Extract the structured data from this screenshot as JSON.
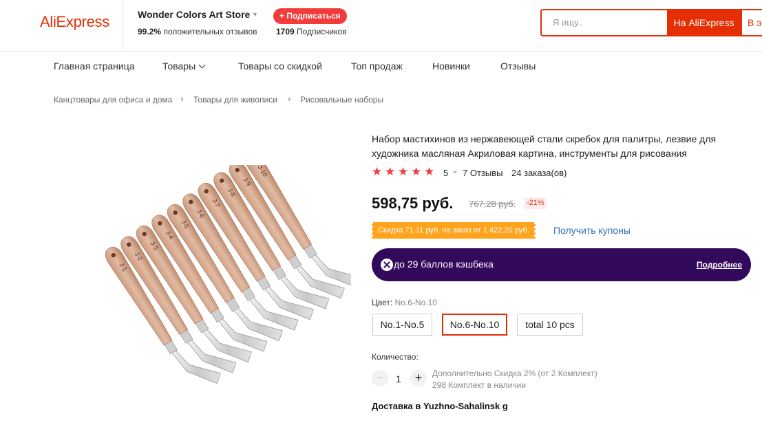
{
  "header": {
    "logo": "AliExpress",
    "store_name": "Wonder Colors Art Store",
    "subscribe_label": "+ Подписаться",
    "positive_reviews_value": "99.2%",
    "positive_reviews_label": "положительных отзывов",
    "subscribers_value": "1709",
    "subscribers_label": "Подписчиков",
    "search_placeholder": "Я ищу..",
    "search_button": "На AliExpress",
    "search_button_store": "В этом магазине"
  },
  "nav": {
    "items": [
      "Главная страница",
      "Товары",
      "Товары со скидкой",
      "Топ продаж",
      "Новинки",
      "Отзывы"
    ]
  },
  "breadcrumb": [
    "Канцтовары для офиса и дома",
    "Товары для живописи",
    "Рисовальные наборы"
  ],
  "product": {
    "title": "Набор мастихинов из нержавеющей стали скребок для палитры, лезвие для художника масляная Акриловая картина, инструменты для рисования",
    "rating": "5",
    "star_count": 5,
    "reviews": "7 Отзывы",
    "orders": "24 заказа(ов)",
    "price": "598,75 руб.",
    "old_price": "767,28 руб.",
    "discount": "-21%",
    "coupon_text": "Скидка 71,11 руб. на заказ от 1 422,20 руб.",
    "coupon_link": "Получить купоны",
    "cashback_text": "до 29 баллов кэшбека",
    "cashback_more": "Подробнее",
    "color_label": "Цвет:",
    "color_value": "No.6-No.10",
    "color_options": [
      "No.1-No.5",
      "No.6-No.10",
      "total 10 pcs"
    ],
    "selected_color_index": 1,
    "quantity_label": "Количество:",
    "quantity": "1",
    "qty_discount": "Дополнительно Скидка 2% (от 2 Комплект)",
    "stock": "298 Комплект в наличии",
    "delivery": "Доставка в Yuzhno-Sahalinsk g"
  },
  "image_labels": [
    "J-1",
    "J-2",
    "J-3",
    "J-4",
    "J-5",
    "J-6",
    "J-7",
    "J-8",
    "J-9",
    "J-10"
  ],
  "colors": {
    "brand": "#e62e04",
    "cashback_bg": "#33095b",
    "coupon_bg": "#ffa41c",
    "star": "#f23c3c",
    "link": "#2e6fb6"
  }
}
